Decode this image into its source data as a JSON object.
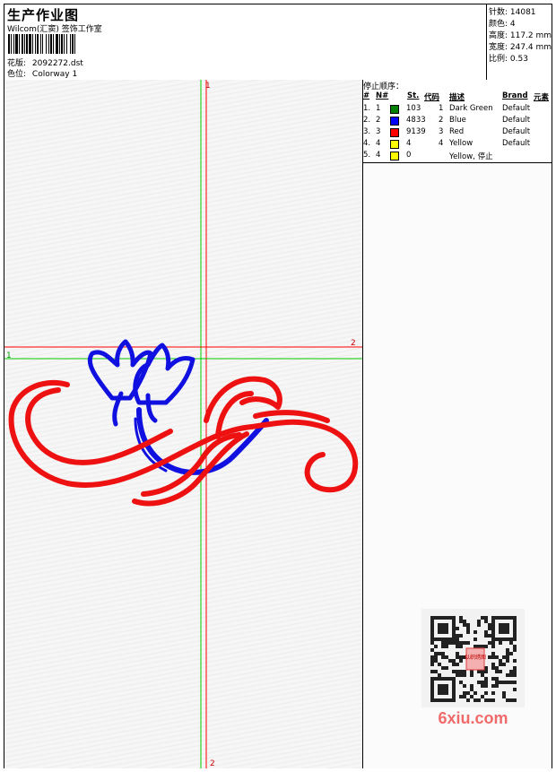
{
  "header": {
    "title": "生产作业图",
    "company": "Wilcom(汇窦) 签饰工作室",
    "design_label": "花版:",
    "design_value": "2092272.dst",
    "colorway_label": "色位:",
    "colorway_value": "Colorway 1"
  },
  "stats": {
    "stitches": "针数: 14081",
    "colors": "颜色: 4",
    "height": "高度: 117.2 mm",
    "width": "宽度: 247.4 mm",
    "scale": "比例: 0.53"
  },
  "sequence": {
    "title": "停止顺序：",
    "headers": [
      "#",
      "N#",
      "St.",
      "代码",
      "描述",
      "Brand",
      "元素"
    ],
    "rows": [
      {
        "idx": "1.",
        "n": "1",
        "color": "#008000",
        "st": "103",
        "code": "1",
        "desc": "Dark Green",
        "brand": "Default"
      },
      {
        "idx": "2.",
        "n": "2",
        "color": "#0000ff",
        "st": "4833",
        "code": "2",
        "desc": "Blue",
        "brand": "Default"
      },
      {
        "idx": "3.",
        "n": "3",
        "color": "#ff0000",
        "st": "9139",
        "code": "3",
        "desc": "Red",
        "brand": "Default"
      },
      {
        "idx": "4.",
        "n": "4",
        "color": "#ffff00",
        "st": "4",
        "code": "4",
        "desc": "Yellow",
        "brand": "Default"
      },
      {
        "idx": "5.",
        "n": "4",
        "color": "#ffff00",
        "st": "0",
        "code": "",
        "desc": "Yellow, 停止",
        "brand": ""
      }
    ]
  },
  "markers": {
    "top_red": "1",
    "right_red": "2",
    "left_green": "1",
    "bottom_red": "2"
  },
  "colors": {
    "guide_red": "#ff0000",
    "guide_green": "#00cc00",
    "stitch_blue": "#1010e0",
    "stitch_red": "#ee1111"
  },
  "watermark": {
    "site": "6xiu.com",
    "stamp": "以织绣图"
  }
}
